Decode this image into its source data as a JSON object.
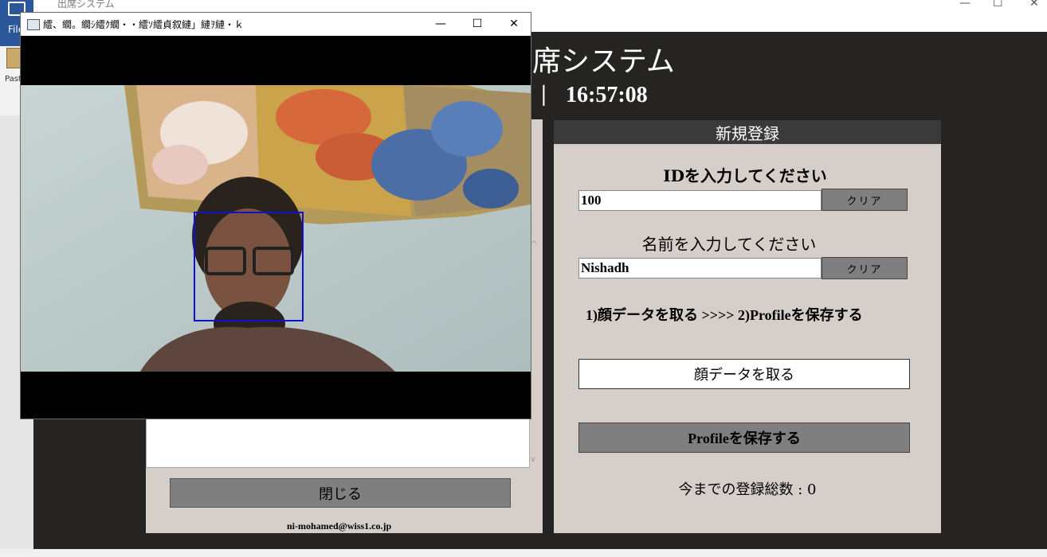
{
  "background_app": {
    "title": "出席システム",
    "file_tab": "File",
    "paste_label": "Paste",
    "window_controls": [
      "—",
      "☐",
      "✕"
    ]
  },
  "app": {
    "title": "席システム",
    "time_separator": "|",
    "time": "16:57:08",
    "close_button": "閉じる",
    "email": "ni-mohamed@wiss1.co.jp",
    "register_panel": {
      "header": "新規登録",
      "id_label": "IDを入力してください",
      "id_value": "100",
      "id_clear": "クリア",
      "name_label": "名前を入力してください",
      "name_value": "Nishadh",
      "name_clear": "クリア",
      "steps": "1)顔データを取る  >>>>  2)Profileを保存する",
      "capture_button": "顔データを取る",
      "save_button": "Profileを保存する",
      "total_label": "今までの登録総数 : 0"
    }
  },
  "camera_window": {
    "title": "繧、繝。繝ｼ繧ｸ繝・・繧ｿ繧貞叙縺」縺ｦ縺・ｋ",
    "controls": [
      "—",
      "☐",
      "✕"
    ],
    "face_box_color": "#1010d0"
  }
}
